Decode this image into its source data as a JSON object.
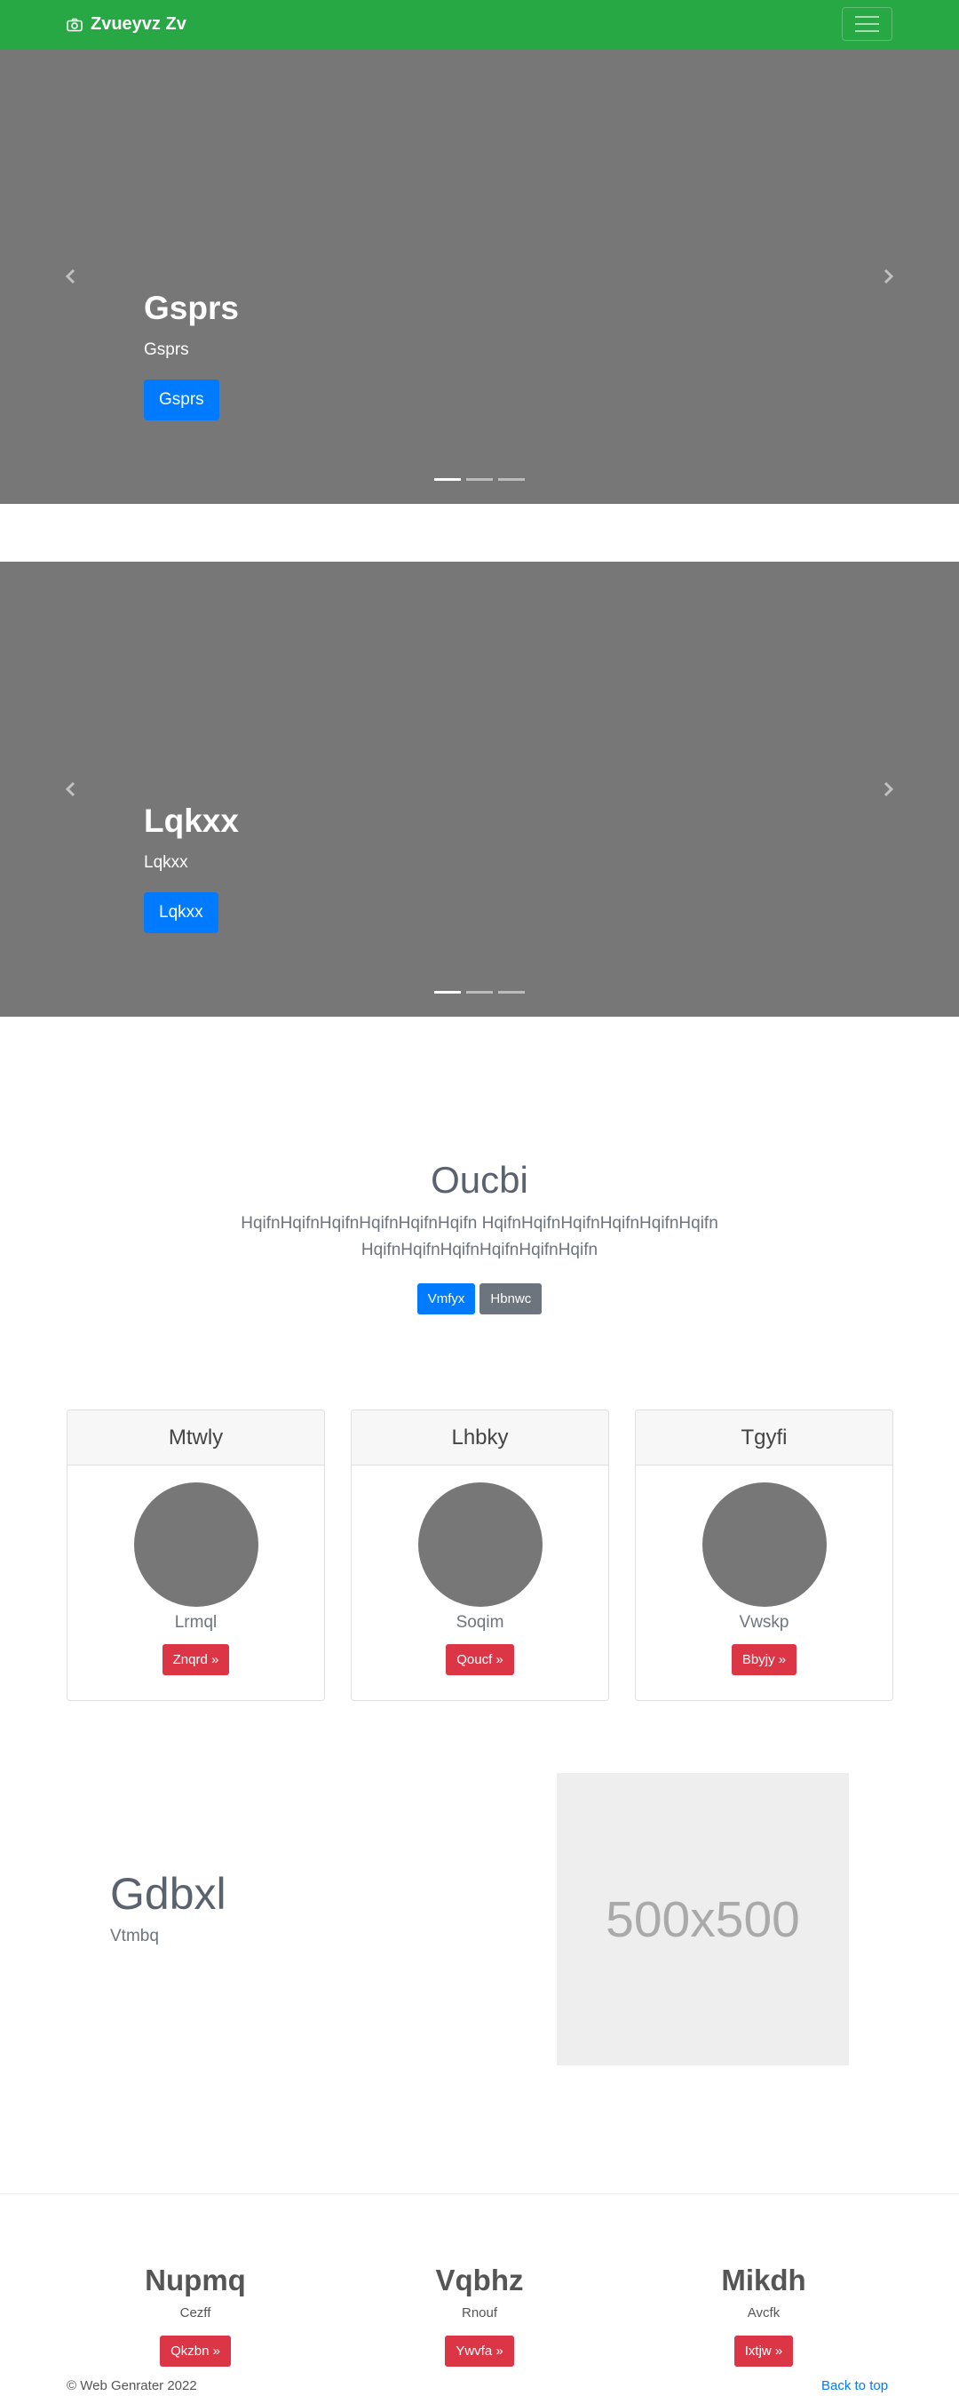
{
  "navbar": {
    "brand": "Zvueyvz Zv",
    "brand_icon": "camera-icon",
    "toggler_icon": "hamburger-icon",
    "color": "#28a745"
  },
  "carousels": [
    {
      "heading": "Gsprs",
      "text": "Gsprs",
      "button": "Gsprs",
      "indicators": 3,
      "active_indicator": 1,
      "prev_icon": "chevron-left-icon",
      "next_icon": "chevron-right-icon"
    },
    {
      "heading": "Lqkxx",
      "text": "Lqkxx",
      "button": "Lqkxx",
      "indicators": 3,
      "active_indicator": 1,
      "prev_icon": "chevron-left-icon",
      "next_icon": "chevron-right-icon"
    }
  ],
  "hero": {
    "title": "Oucbi",
    "lead": "HqifnHqifnHqifnHqifnHqifnHqifn HqifnHqifnHqifnHqifnHqifnHqifn HqifnHqifnHqifnHqifnHqifnHqifn",
    "primary_button": "Vmfyx",
    "secondary_button": "Hbnwc"
  },
  "cards": [
    {
      "title": "Mtwly",
      "text": "Lrmql",
      "button": "Znqrd »"
    },
    {
      "title": "Lhbky",
      "text": "Soqim",
      "button": "Qoucf »"
    },
    {
      "title": "Tgyfi",
      "text": "Vwskp",
      "button": "Bbyjy »"
    }
  ],
  "feature": {
    "heading": "Gdbxl",
    "subheading": "Vtmbq",
    "placeholder": "500x500"
  },
  "columns": [
    {
      "title": "Nupmq",
      "text": "Cezff",
      "button": "Qkzbn »"
    },
    {
      "title": "Vqbhz",
      "text": "Rnouf",
      "button": "Ywvfa »"
    },
    {
      "title": "Mikdh",
      "text": "Avcfk",
      "button": "Ixtjw »"
    }
  ],
  "footer": {
    "copyright": "© Web Genrater 2022",
    "back_to_top": "Back to top"
  }
}
